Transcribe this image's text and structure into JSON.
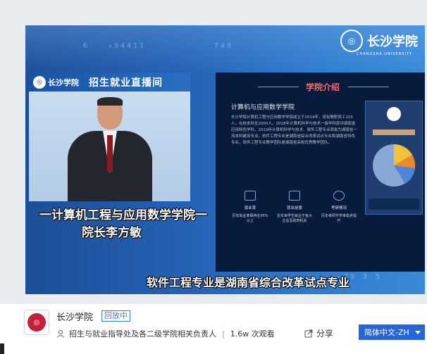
{
  "video": {
    "bg_numbers_top": [
      "6",
      "ᴧ94411",
      "749"
    ],
    "bg_numbers_bottom": "79 3 5",
    "school_logo_text": "长沙学院",
    "school_logo_en": "CHANGSHA UNIVERSITY",
    "inset": {
      "banner_school": "长沙学院",
      "banner_live": "招生就业直播间"
    },
    "slide": {
      "header": "学院介绍",
      "title": "计算机与应用数学学院",
      "body": "长沙学院计算机工程与应用数学学院成立于2014年，现有教职员工105人，在校本科生2000人。2018年计算机科学与技术一级学科获评湖南省应用特色学科，2019年计算机科学与技术、软件工程专业获批为湖南省一流本科建设专业。软件工程专业是湖南省综合改革试点专业和湖南省特色专业，软件工程专业教学团队是湖南省高校优秀教学团队。",
      "stats": [
        {
          "label": "就业率",
          "text": "历年就业率保持在95%以上"
        },
        {
          "label": "就业前景",
          "text": "近年来学生就业于各大企业及政府机关"
        },
        {
          "label": "考研情况",
          "text": "历年考研升学率稳步提升"
        }
      ]
    },
    "subtitles": {
      "line1": "一计算机工程与应用数学学院一",
      "line2": "院长李方敏",
      "line3": "软件工程专业是湖南省综合改革试点专业"
    }
  },
  "info": {
    "channel": "长沙学院",
    "badge": "回放中",
    "presenter": "招生与就业指导处及各二级学院相关负责人",
    "separator": "|",
    "views": "1.6w 次观看",
    "share": "分享",
    "language": "简体中文-ZH"
  }
}
